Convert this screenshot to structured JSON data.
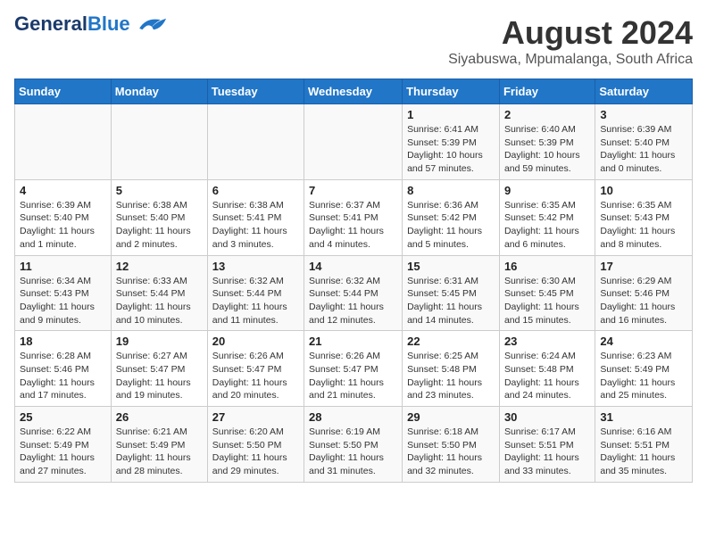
{
  "header": {
    "logo_general": "General",
    "logo_blue": "Blue",
    "title": "August 2024",
    "subtitle": "Siyabuswa, Mpumalanga, South Africa"
  },
  "days_of_week": [
    "Sunday",
    "Monday",
    "Tuesday",
    "Wednesday",
    "Thursday",
    "Friday",
    "Saturday"
  ],
  "weeks": [
    [
      {
        "day": "",
        "info": ""
      },
      {
        "day": "",
        "info": ""
      },
      {
        "day": "",
        "info": ""
      },
      {
        "day": "",
        "info": ""
      },
      {
        "day": "1",
        "info": "Sunrise: 6:41 AM\nSunset: 5:39 PM\nDaylight: 10 hours and 57 minutes."
      },
      {
        "day": "2",
        "info": "Sunrise: 6:40 AM\nSunset: 5:39 PM\nDaylight: 10 hours and 59 minutes."
      },
      {
        "day": "3",
        "info": "Sunrise: 6:39 AM\nSunset: 5:40 PM\nDaylight: 11 hours and 0 minutes."
      }
    ],
    [
      {
        "day": "4",
        "info": "Sunrise: 6:39 AM\nSunset: 5:40 PM\nDaylight: 11 hours and 1 minute."
      },
      {
        "day": "5",
        "info": "Sunrise: 6:38 AM\nSunset: 5:40 PM\nDaylight: 11 hours and 2 minutes."
      },
      {
        "day": "6",
        "info": "Sunrise: 6:38 AM\nSunset: 5:41 PM\nDaylight: 11 hours and 3 minutes."
      },
      {
        "day": "7",
        "info": "Sunrise: 6:37 AM\nSunset: 5:41 PM\nDaylight: 11 hours and 4 minutes."
      },
      {
        "day": "8",
        "info": "Sunrise: 6:36 AM\nSunset: 5:42 PM\nDaylight: 11 hours and 5 minutes."
      },
      {
        "day": "9",
        "info": "Sunrise: 6:35 AM\nSunset: 5:42 PM\nDaylight: 11 hours and 6 minutes."
      },
      {
        "day": "10",
        "info": "Sunrise: 6:35 AM\nSunset: 5:43 PM\nDaylight: 11 hours and 8 minutes."
      }
    ],
    [
      {
        "day": "11",
        "info": "Sunrise: 6:34 AM\nSunset: 5:43 PM\nDaylight: 11 hours and 9 minutes."
      },
      {
        "day": "12",
        "info": "Sunrise: 6:33 AM\nSunset: 5:44 PM\nDaylight: 11 hours and 10 minutes."
      },
      {
        "day": "13",
        "info": "Sunrise: 6:32 AM\nSunset: 5:44 PM\nDaylight: 11 hours and 11 minutes."
      },
      {
        "day": "14",
        "info": "Sunrise: 6:32 AM\nSunset: 5:44 PM\nDaylight: 11 hours and 12 minutes."
      },
      {
        "day": "15",
        "info": "Sunrise: 6:31 AM\nSunset: 5:45 PM\nDaylight: 11 hours and 14 minutes."
      },
      {
        "day": "16",
        "info": "Sunrise: 6:30 AM\nSunset: 5:45 PM\nDaylight: 11 hours and 15 minutes."
      },
      {
        "day": "17",
        "info": "Sunrise: 6:29 AM\nSunset: 5:46 PM\nDaylight: 11 hours and 16 minutes."
      }
    ],
    [
      {
        "day": "18",
        "info": "Sunrise: 6:28 AM\nSunset: 5:46 PM\nDaylight: 11 hours and 17 minutes."
      },
      {
        "day": "19",
        "info": "Sunrise: 6:27 AM\nSunset: 5:47 PM\nDaylight: 11 hours and 19 minutes."
      },
      {
        "day": "20",
        "info": "Sunrise: 6:26 AM\nSunset: 5:47 PM\nDaylight: 11 hours and 20 minutes."
      },
      {
        "day": "21",
        "info": "Sunrise: 6:26 AM\nSunset: 5:47 PM\nDaylight: 11 hours and 21 minutes."
      },
      {
        "day": "22",
        "info": "Sunrise: 6:25 AM\nSunset: 5:48 PM\nDaylight: 11 hours and 23 minutes."
      },
      {
        "day": "23",
        "info": "Sunrise: 6:24 AM\nSunset: 5:48 PM\nDaylight: 11 hours and 24 minutes."
      },
      {
        "day": "24",
        "info": "Sunrise: 6:23 AM\nSunset: 5:49 PM\nDaylight: 11 hours and 25 minutes."
      }
    ],
    [
      {
        "day": "25",
        "info": "Sunrise: 6:22 AM\nSunset: 5:49 PM\nDaylight: 11 hours and 27 minutes."
      },
      {
        "day": "26",
        "info": "Sunrise: 6:21 AM\nSunset: 5:49 PM\nDaylight: 11 hours and 28 minutes."
      },
      {
        "day": "27",
        "info": "Sunrise: 6:20 AM\nSunset: 5:50 PM\nDaylight: 11 hours and 29 minutes."
      },
      {
        "day": "28",
        "info": "Sunrise: 6:19 AM\nSunset: 5:50 PM\nDaylight: 11 hours and 31 minutes."
      },
      {
        "day": "29",
        "info": "Sunrise: 6:18 AM\nSunset: 5:50 PM\nDaylight: 11 hours and 32 minutes."
      },
      {
        "day": "30",
        "info": "Sunrise: 6:17 AM\nSunset: 5:51 PM\nDaylight: 11 hours and 33 minutes."
      },
      {
        "day": "31",
        "info": "Sunrise: 6:16 AM\nSunset: 5:51 PM\nDaylight: 11 hours and 35 minutes."
      }
    ]
  ]
}
